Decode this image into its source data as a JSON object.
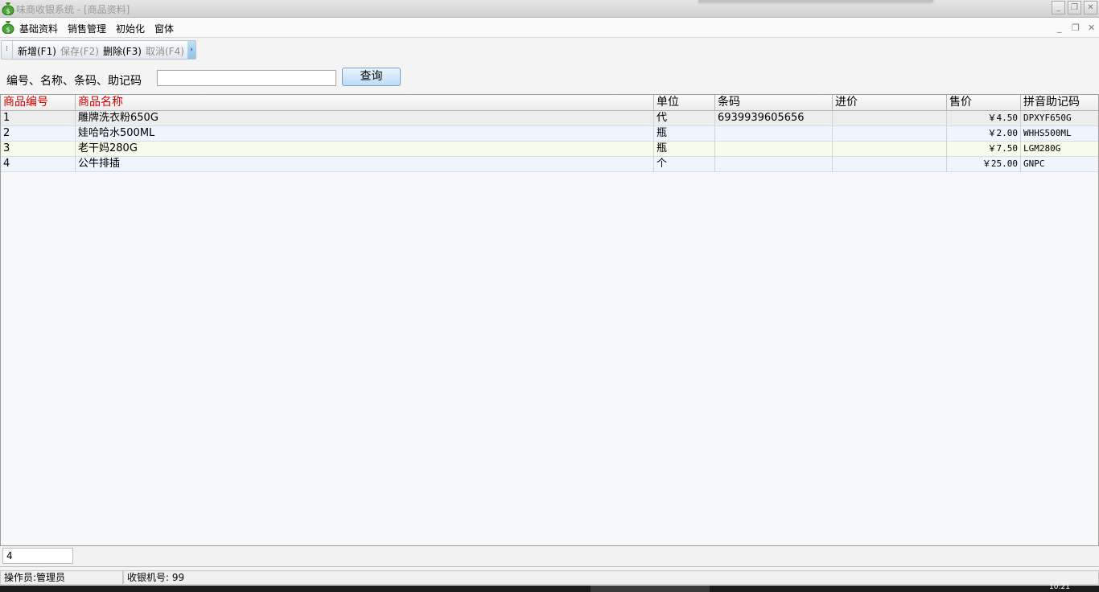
{
  "window": {
    "title": "味商收银系统 - [商品资料]",
    "controls": {
      "minimize": "_",
      "restore": "❐",
      "close": "✕"
    }
  },
  "menu": {
    "items": [
      "基础资料",
      "销售管理",
      "初始化",
      "窗体"
    ],
    "mdi_controls": {
      "minimize": "_",
      "restore": "❐",
      "close": "✕"
    }
  },
  "toolbar": {
    "new_label": "新增(F1)",
    "save_label": "保存(F2)",
    "delete_label": "删除(F3)",
    "cancel_label": "取消(F4)"
  },
  "search": {
    "label": "编号、名称、条码、助记码",
    "value": "",
    "button_label": "查询"
  },
  "grid": {
    "columns": [
      "商品编号",
      "商品名称",
      "单位",
      "条码",
      "进价",
      "售价",
      "拼音助记码"
    ],
    "rows": [
      {
        "id": "1",
        "name": "雕牌洗衣粉650G",
        "unit": "代",
        "barcode": "6939939605656",
        "cost": "",
        "price": "￥4.50",
        "code": "DPXYF650G"
      },
      {
        "id": "2",
        "name": "娃哈哈水500ML",
        "unit": "瓶",
        "barcode": "",
        "cost": "",
        "price": "￥2.00",
        "code": "WHHS500ML"
      },
      {
        "id": "3",
        "name": "老干妈280G",
        "unit": "瓶",
        "barcode": "",
        "cost": "",
        "price": "￥7.50",
        "code": "LGM280G"
      },
      {
        "id": "4",
        "name": "公牛排插",
        "unit": "个",
        "barcode": "",
        "cost": "",
        "price": "￥25.00",
        "code": "GNPC"
      }
    ]
  },
  "footer": {
    "record_count": "4"
  },
  "status": {
    "operator": "操作员:管理员",
    "register": "收银机号: 99"
  },
  "taskbar": {
    "clock": "10:21"
  },
  "colors": {
    "required_header": "#d00000",
    "row_odd": "#f7fbeb",
    "row_even": "#eef5fc"
  }
}
